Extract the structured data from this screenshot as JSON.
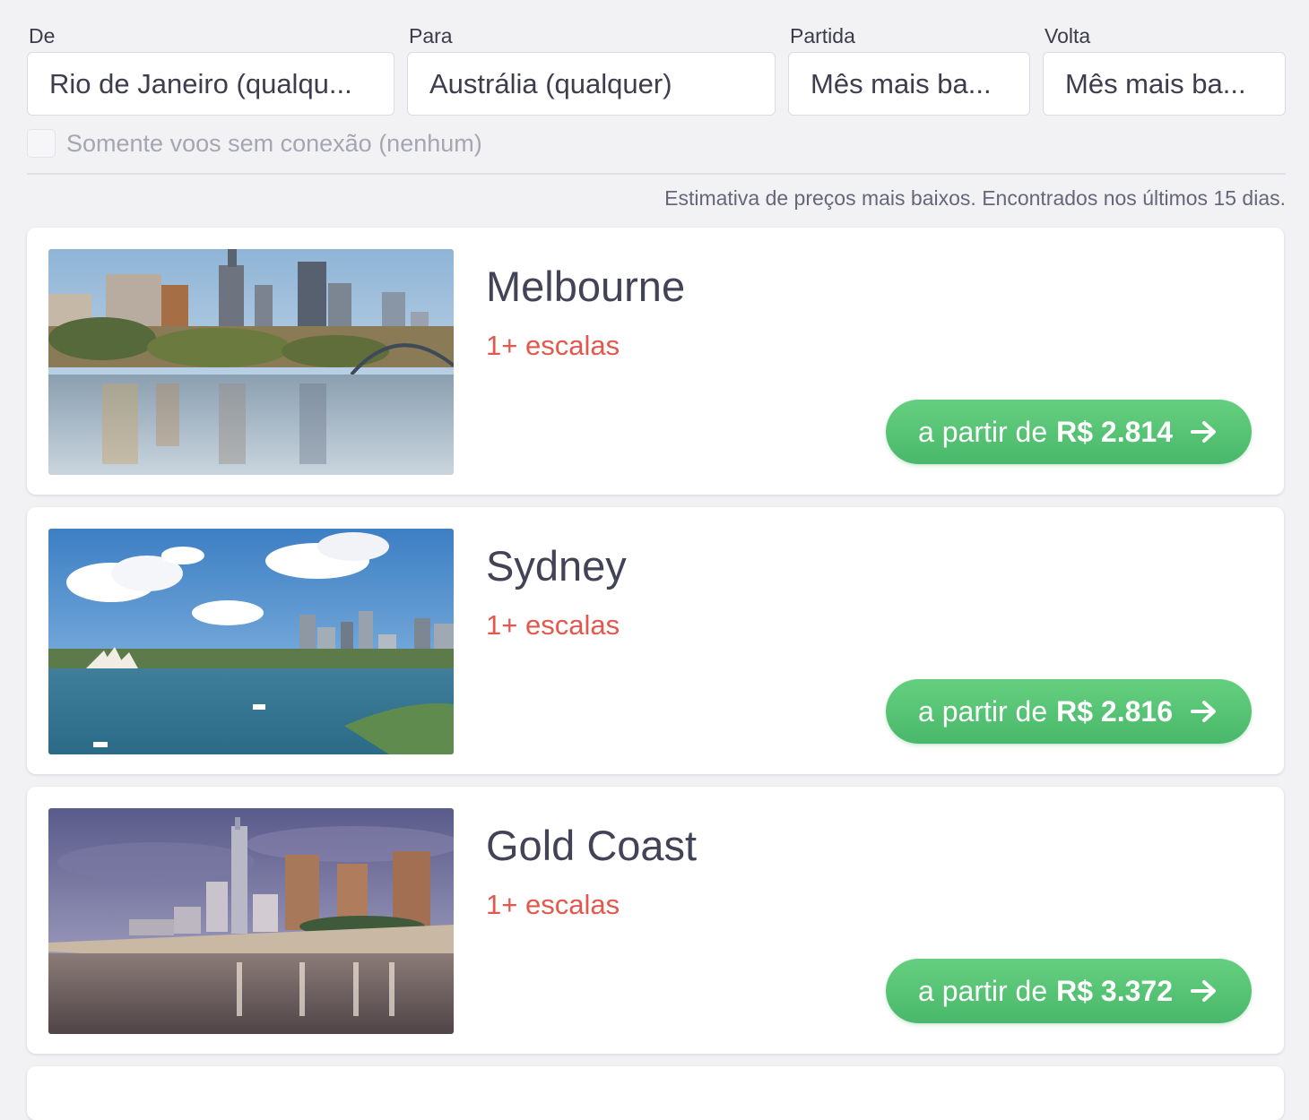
{
  "search": {
    "from_label": "De",
    "from_value": "Rio de Janeiro (qualqu...",
    "to_label": "Para",
    "to_value": "Austrália (qualquer)",
    "departure_label": "Partida",
    "departure_value": "Mês mais ba...",
    "return_label": "Volta",
    "return_value": "Mês mais ba...",
    "direct_only_label": "Somente voos sem conexão (nenhum)",
    "direct_only_checked": false
  },
  "note": "Estimativa de preços mais baixos. Encontrados nos últimos 15 dias.",
  "results": [
    {
      "city": "Melbourne",
      "stops": "1+ escalas",
      "price_prefix": "a partir de",
      "price": "R$ 2.814",
      "image": "melbourne-skyline-photo"
    },
    {
      "city": "Sydney",
      "stops": "1+ escalas",
      "price_prefix": "a partir de",
      "price": "R$ 2.816",
      "image": "sydney-harbour-photo"
    },
    {
      "city": "Gold Coast",
      "stops": "1+ escalas",
      "price_prefix": "a partir de",
      "price": "R$ 3.372",
      "image": "gold-coast-beach-photo"
    }
  ],
  "colors": {
    "background": "#f2f2f5",
    "stops_text": "#e4574d",
    "price_button": "#55c271",
    "city_text": "#434358"
  },
  "icons": {
    "price_arrow": "arrow-right-icon"
  }
}
